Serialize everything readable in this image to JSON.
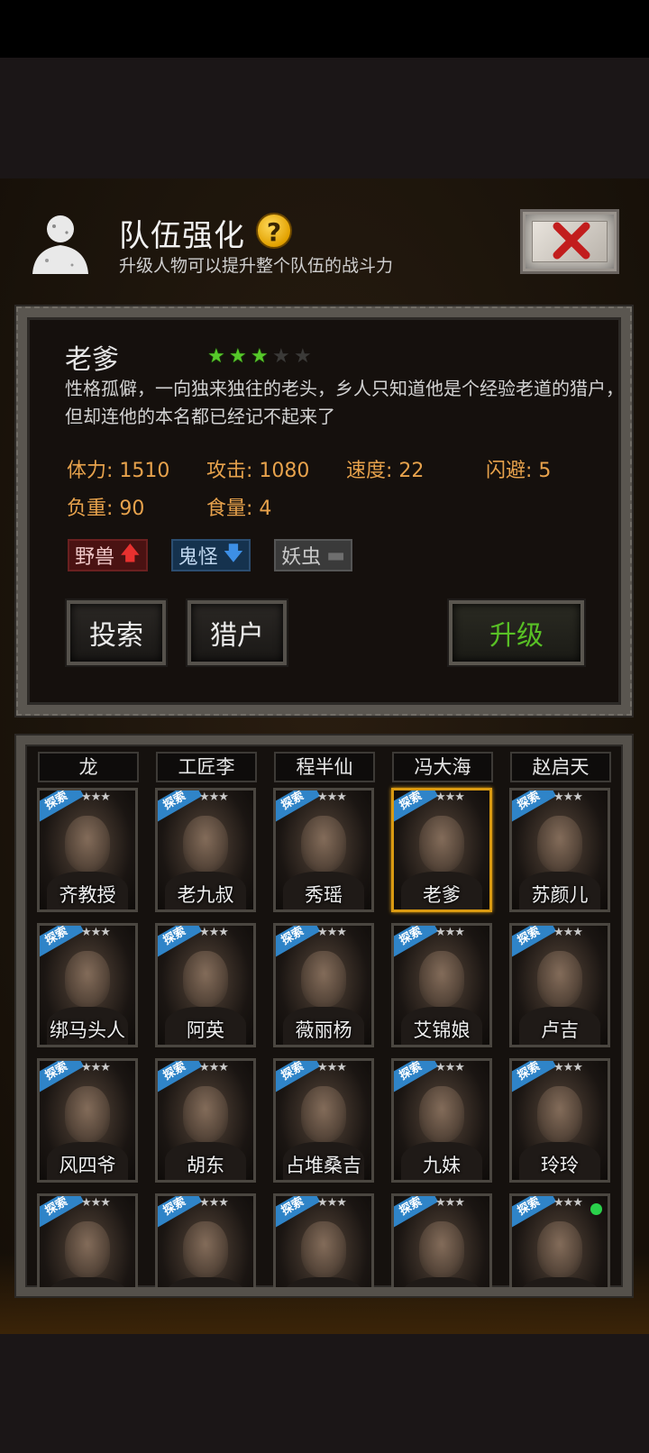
{
  "header": {
    "title": "队伍强化",
    "help_glyph": "?",
    "subtitle": "升级人物可以提升整个队伍的战斗力"
  },
  "detail": {
    "name": "老爹",
    "stars_filled": 3,
    "stars_total": 5,
    "description": "性格孤僻，一向独来独往的老头，乡人只知道他是个经验老道的猎户，但却连他的本名都已经记不起来了",
    "stats": {
      "stamina": "体力: 1510",
      "attack": "攻击: 1080",
      "speed": "速度: 22",
      "dodge": "闪避: 5",
      "load": "负重: 90",
      "food": "食量: 4"
    },
    "tags": {
      "beast": "野兽",
      "ghost": "鬼怪",
      "insect": "妖虫"
    },
    "buttons": {
      "explore": "投索",
      "hunter": "猎户",
      "upgrade": "升级"
    }
  },
  "roster": {
    "name_row": [
      "龙",
      "工匠李",
      "程半仙",
      "冯大海",
      "赵启天"
    ],
    "badge_label": "探索",
    "star_glyphs": "★★★",
    "characters": [
      {
        "name": "齐教授"
      },
      {
        "name": "老九叔"
      },
      {
        "name": "秀瑶"
      },
      {
        "name": "老爹",
        "selected": true
      },
      {
        "name": "苏颜儿"
      },
      {
        "name": "绑马头人"
      },
      {
        "name": "阿英"
      },
      {
        "name": "薇丽杨"
      },
      {
        "name": "艾锦娘"
      },
      {
        "name": "卢吉"
      },
      {
        "name": "风四爷"
      },
      {
        "name": "胡东"
      },
      {
        "name": "占堆桑吉"
      },
      {
        "name": "九妹"
      },
      {
        "name": "玲玲"
      },
      {
        "name": ""
      },
      {
        "name": ""
      },
      {
        "name": ""
      },
      {
        "name": ""
      },
      {
        "name": "",
        "online": true
      }
    ]
  },
  "colors": {
    "stat_text": "#e7a24c",
    "upgrade_text": "#58c025",
    "selected_border": "#d99a12",
    "explore_badge": "#2f84c8"
  }
}
